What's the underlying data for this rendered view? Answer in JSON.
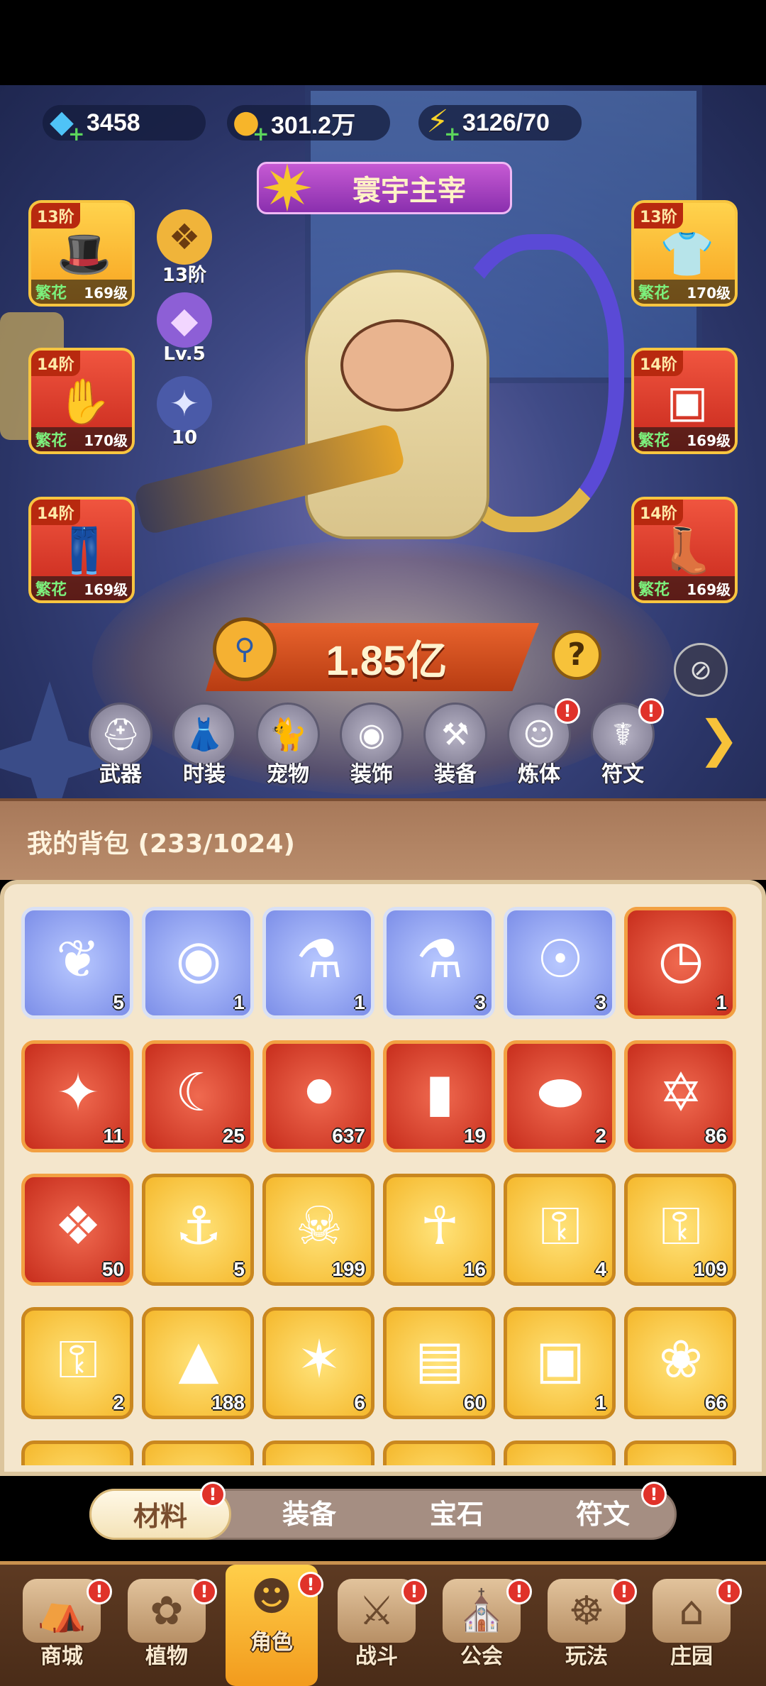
{
  "currencies": {
    "gems": "3458",
    "gold": "301.2万",
    "energy": "3126/70"
  },
  "title_plate": "寰宇主宰",
  "equipment_left": [
    {
      "tier": "13阶",
      "quality": "繁花",
      "level": "169级",
      "icon": "hat-icon"
    },
    {
      "tier": "14阶",
      "quality": "繁花",
      "level": "170级",
      "icon": "gloves-icon"
    },
    {
      "tier": "14阶",
      "quality": "繁花",
      "level": "169级",
      "icon": "pants-icon"
    }
  ],
  "equipment_right": [
    {
      "tier": "13阶",
      "quality": "繁花",
      "level": "170级",
      "icon": "jacket-icon"
    },
    {
      "tier": "14阶",
      "quality": "繁花",
      "level": "169级",
      "icon": "belt-icon"
    },
    {
      "tier": "14阶",
      "quality": "繁花",
      "level": "169级",
      "icon": "boots-icon"
    }
  ],
  "side_stats": [
    {
      "label": "13阶",
      "icon": "paw-badge-icon"
    },
    {
      "label": "Lv.5",
      "icon": "crystal-icon"
    },
    {
      "label": "10",
      "icon": "star-orb-icon"
    }
  ],
  "combat_power": "1.85亿",
  "feature_tabs": [
    {
      "label": "武器",
      "icon": "gun-icon",
      "alert": false
    },
    {
      "label": "时装",
      "icon": "outfit-icon",
      "alert": false
    },
    {
      "label": "宠物",
      "icon": "pet-icon",
      "alert": false
    },
    {
      "label": "装饰",
      "icon": "mask-icon",
      "alert": false
    },
    {
      "label": "装备",
      "icon": "armor-icon",
      "alert": false
    },
    {
      "label": "炼体",
      "icon": "body-icon",
      "alert": true
    },
    {
      "label": "符文",
      "icon": "rune-icon",
      "alert": true
    }
  ],
  "alert_mark": "!",
  "bag": {
    "title": "我的背包 (233/1024)",
    "items": [
      {
        "count": "5",
        "icon": "scarab-icon",
        "rarity": "blue"
      },
      {
        "count": "1",
        "icon": "mask-item-icon",
        "rarity": "blue"
      },
      {
        "count": "1",
        "icon": "potion-vial-icon",
        "rarity": "blue"
      },
      {
        "count": "3",
        "icon": "potion-vial-cloud-icon",
        "rarity": "blue"
      },
      {
        "count": "3",
        "icon": "compass-orb-icon",
        "rarity": "blue"
      },
      {
        "count": "1",
        "icon": "clock-card-icon",
        "rarity": "red"
      },
      {
        "count": "11",
        "icon": "blue-star-icon",
        "rarity": "red"
      },
      {
        "count": "25",
        "icon": "moon-star-icon",
        "rarity": "red"
      },
      {
        "count": "637",
        "icon": "red-potion-icon",
        "rarity": "red"
      },
      {
        "count": "19",
        "icon": "green-tube-icon",
        "rarity": "red"
      },
      {
        "count": "2",
        "icon": "green-capsule-icon",
        "rarity": "red"
      },
      {
        "count": "86",
        "icon": "hexagram-crystal-icon",
        "rarity": "red"
      },
      {
        "count": "50",
        "icon": "cube-cluster-icon",
        "rarity": "red"
      },
      {
        "count": "5",
        "icon": "perfume-bottle-icon",
        "rarity": "gold"
      },
      {
        "count": "199",
        "icon": "skull-card-icon",
        "rarity": "gold"
      },
      {
        "count": "16",
        "icon": "ankh-icon",
        "rarity": "gold"
      },
      {
        "count": "4",
        "icon": "ruby-key-icon",
        "rarity": "gold"
      },
      {
        "count": "109",
        "icon": "ornate-key-icon",
        "rarity": "gold"
      },
      {
        "count": "2",
        "icon": "emerald-key-icon",
        "rarity": "gold"
      },
      {
        "count": "188",
        "icon": "prism-icon",
        "rarity": "gold"
      },
      {
        "count": "6",
        "icon": "star-compass-icon",
        "rarity": "gold"
      },
      {
        "count": "60",
        "icon": "red-book-icon",
        "rarity": "gold"
      },
      {
        "count": "1",
        "icon": "green-cube-icon",
        "rarity": "gold"
      },
      {
        "count": "66",
        "icon": "golden-flower-icon",
        "rarity": "gold"
      }
    ]
  },
  "categories": [
    {
      "label": "材料",
      "active": true,
      "alert": true
    },
    {
      "label": "装备",
      "active": false,
      "alert": false
    },
    {
      "label": "宝石",
      "active": false,
      "alert": false
    },
    {
      "label": "符文",
      "active": false,
      "alert": true
    }
  ],
  "bottom_nav": [
    {
      "label": "商城",
      "icon": "shop-icon",
      "active": false,
      "alert": true
    },
    {
      "label": "植物",
      "icon": "plant-icon",
      "active": false,
      "alert": true
    },
    {
      "label": "角色",
      "icon": "character-icon",
      "active": true,
      "alert": true
    },
    {
      "label": "战斗",
      "icon": "battle-icon",
      "active": false,
      "alert": true
    },
    {
      "label": "公会",
      "icon": "guild-icon",
      "active": false,
      "alert": true
    },
    {
      "label": "玩法",
      "icon": "gameplay-icon",
      "active": false,
      "alert": true
    },
    {
      "label": "庄园",
      "icon": "manor-icon",
      "active": false,
      "alert": true
    }
  ],
  "colors": {
    "rarity_blue": "#8fa0ee",
    "rarity_red": "#d9402b",
    "rarity_gold": "#f5c03a",
    "alert_red": "#e0322a",
    "nav_active": "#f7b52a"
  }
}
